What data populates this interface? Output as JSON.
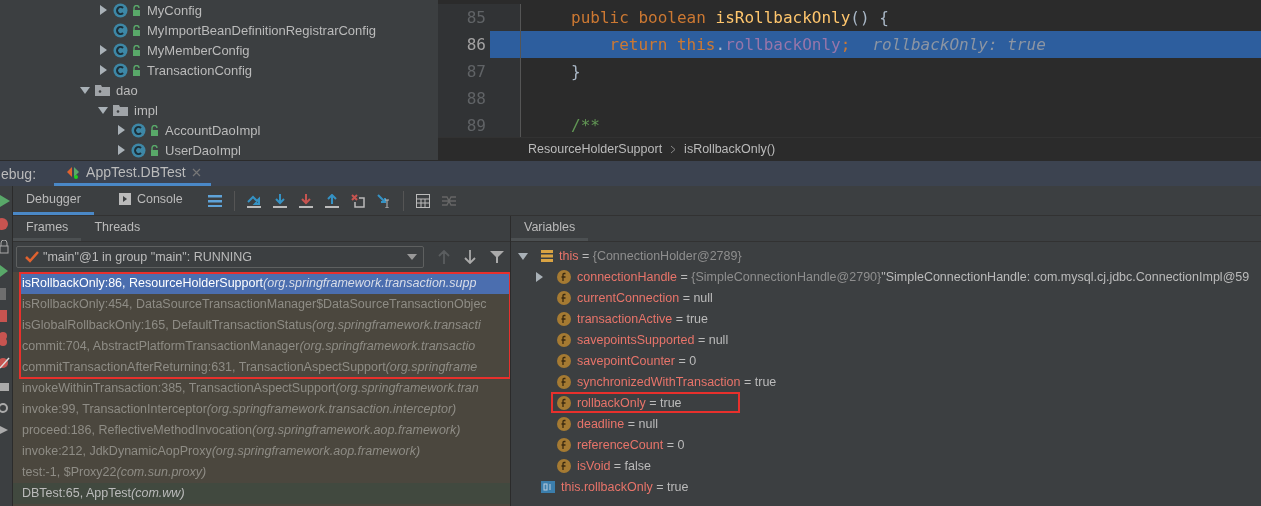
{
  "project_tree": [
    {
      "kind": "group",
      "children": [
        {
          "kind": "class",
          "label": "MyConfig",
          "expandable": true,
          "expanded": false
        },
        {
          "kind": "class",
          "label": "MyImportBeanDefinitionRegistrarConfig",
          "expandable": false
        },
        {
          "kind": "class",
          "label": "MyMemberConfig",
          "expandable": true,
          "expanded": false
        },
        {
          "kind": "class",
          "label": "TransactionConfig",
          "expandable": true,
          "expanded": false
        }
      ]
    },
    {
      "kind": "package",
      "label": "dao",
      "expandable": true,
      "expanded": true,
      "children": [
        {
          "kind": "package",
          "label": "impl",
          "expandable": true,
          "expanded": true,
          "children": [
            {
              "kind": "class",
              "label": "AccountDaoImpl",
              "expandable": true,
              "expanded": false
            },
            {
              "kind": "class",
              "label": "UserDaoImpl",
              "expandable": true,
              "expanded": false
            }
          ]
        }
      ]
    }
  ],
  "editor": {
    "lines": [
      {
        "number": "85",
        "selected": false,
        "tokens": [
          {
            "kind": "keyword",
            "text": "public boolean "
          },
          {
            "kind": "method",
            "text": "isRollbackOnly"
          },
          {
            "kind": "plain",
            "text": "() {"
          }
        ]
      },
      {
        "number": "86",
        "selected": true,
        "tokens": [
          {
            "kind": "keyword",
            "text": "    return this"
          },
          {
            "kind": "plain",
            "text": "."
          },
          {
            "kind": "field",
            "text": "rollbackOnly"
          },
          {
            "kind": "keyword",
            "text": ";"
          },
          {
            "kind": "hint",
            "text": "rollbackOnly: true"
          }
        ]
      },
      {
        "number": "87",
        "selected": false,
        "tokens": [
          {
            "kind": "plain",
            "text": "}"
          }
        ]
      },
      {
        "number": "88",
        "selected": false
      },
      {
        "number": "89",
        "selected": false,
        "tokens": [
          {
            "kind": "comment",
            "text": "/**"
          }
        ]
      }
    ],
    "breadcrumbs": [
      "ResourceHolderSupport",
      "isRollbackOnly()"
    ]
  },
  "debug": {
    "label": "ebug:",
    "session_tab": "AppTest.DBTest",
    "tabs": [
      {
        "label": "Debugger",
        "selected": true
      },
      {
        "label": "Console",
        "selected": false
      }
    ],
    "frames_tabs": [
      {
        "label": "Frames",
        "selected": true
      },
      {
        "label": "Threads",
        "selected": false
      }
    ],
    "thread": "\"main\"@1 in group \"main\": RUNNING",
    "frames": [
      {
        "kind": "library",
        "method": "isRollbackOnly:86, ResourceHolderSupport",
        "package": "(org.springframework.transaction.supp",
        "selected": true,
        "boxed": true
      },
      {
        "kind": "library",
        "method": "isRollbackOnly:454, DataSourceTransactionManager$DataSourceTransactionObjec",
        "selected": false,
        "boxed": true
      },
      {
        "kind": "library",
        "method": "isGlobalRollbackOnly:165, DefaultTransactionStatus",
        "package": "(org.springframework.transacti",
        "selected": false,
        "boxed": true
      },
      {
        "kind": "library",
        "method": "commit:704, AbstractPlatformTransactionManager",
        "package": "(org.springframework.transactio",
        "selected": false,
        "boxed": true
      },
      {
        "kind": "library",
        "method": "commitTransactionAfterReturning:631, TransactionAspectSupport",
        "package": "(org.springframe",
        "selected": false,
        "boxed": true
      },
      {
        "kind": "library",
        "method": "invokeWithinTransaction:385, TransactionAspectSupport",
        "package": "(org.springframework.tran",
        "selected": false,
        "boxed": false
      },
      {
        "kind": "library",
        "method": "invoke:99, TransactionInterceptor",
        "package": "(org.springframework.transaction.interceptor)",
        "selected": false,
        "boxed": false
      },
      {
        "kind": "library",
        "method": "proceed:186, ReflectiveMethodInvocation",
        "package": "(org.springframework.aop.framework)",
        "selected": false,
        "boxed": false
      },
      {
        "kind": "library",
        "method": "invoke:212, JdkDynamicAopProxy",
        "package": "(org.springframework.aop.framework)",
        "selected": false,
        "boxed": false
      },
      {
        "kind": "library",
        "method": "test:-1, $Proxy22",
        "package": "(com.sun.proxy)",
        "selected": false,
        "boxed": false
      },
      {
        "kind": "user",
        "method": "DBTest:65, AppTest",
        "package": "(com.ww)",
        "selected": false,
        "boxed": false
      }
    ],
    "variables_title": "Variables",
    "variables": [
      {
        "kind": "object",
        "name": "this",
        "operator": "=",
        "ref": "{ConnectionHolder@2789}",
        "expandable": true,
        "expanded": true,
        "boxed": false,
        "children": [
          {
            "kind": "field",
            "name": "connectionHandle",
            "operator": "=",
            "ref": "{SimpleConnectionHandle@2790}",
            "value": "\"SimpleConnectionHandle: com.mysql.cj.jdbc.ConnectionImpl@59",
            "expandable": true,
            "expanded": false,
            "boxed": false
          },
          {
            "kind": "field",
            "name": "currentConnection",
            "operator": "=",
            "value": "null",
            "expandable": false,
            "boxed": false
          },
          {
            "kind": "field",
            "name": "transactionActive",
            "operator": "=",
            "value": "true",
            "expandable": false,
            "boxed": false
          },
          {
            "kind": "field",
            "name": "savepointsSupported",
            "operator": "=",
            "value": "null",
            "expandable": false,
            "boxed": false
          },
          {
            "kind": "field",
            "name": "savepointCounter",
            "operator": "=",
            "value": "0",
            "expandable": false,
            "boxed": false
          },
          {
            "kind": "field",
            "name": "synchronizedWithTransaction",
            "operator": "=",
            "value": "true",
            "expandable": false,
            "boxed": false
          },
          {
            "kind": "field",
            "name": "rollbackOnly",
            "operator": "=",
            "value": "true",
            "expandable": false,
            "boxed": true
          },
          {
            "kind": "field",
            "name": "deadline",
            "operator": "=",
            "value": "null",
            "expandable": false,
            "boxed": false
          },
          {
            "kind": "field",
            "name": "referenceCount",
            "operator": "=",
            "value": "0",
            "expandable": false,
            "boxed": false
          },
          {
            "kind": "field",
            "name": "isVoid",
            "operator": "=",
            "value": "false",
            "expandable": false,
            "boxed": false
          }
        ]
      },
      {
        "kind": "watch",
        "name": "this.rollbackOnly",
        "operator": "=",
        "value": "true",
        "expandable": false,
        "boxed": false
      }
    ]
  }
}
